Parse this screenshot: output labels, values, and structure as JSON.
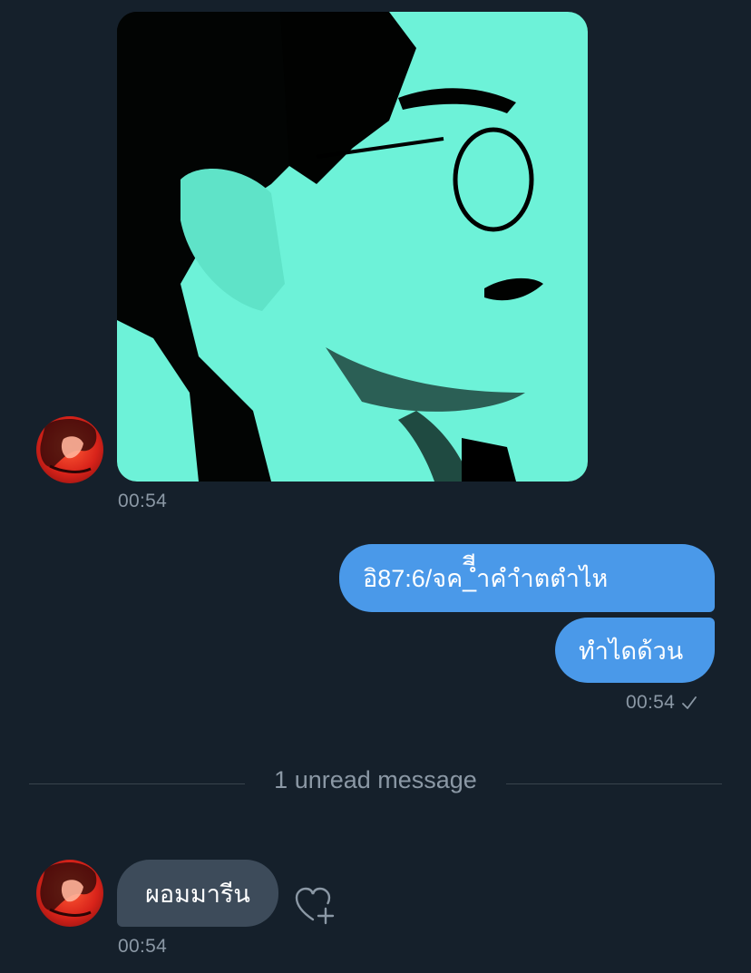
{
  "messages": {
    "incoming_image": {
      "time": "00:54"
    },
    "outgoing": {
      "bubble_1": "อิ87:6/จค_ีีำคำำตตำไห",
      "bubble_2": "ทำไดด้วน",
      "time": "00:54",
      "status_icon": "checkmark-icon"
    },
    "unread_divider": {
      "label": "1 unread message"
    },
    "incoming_text": {
      "text": "ผอมมารีน",
      "time": "00:54",
      "reaction_icon": "heart-plus-icon"
    }
  },
  "colors": {
    "background": "#15202b",
    "outgoing_bubble": "#4a99e9",
    "incoming_bubble": "#3d4b5a",
    "muted_text": "#8b98a5",
    "divider": "#38444d",
    "photo_tint": "#6df2d8"
  }
}
